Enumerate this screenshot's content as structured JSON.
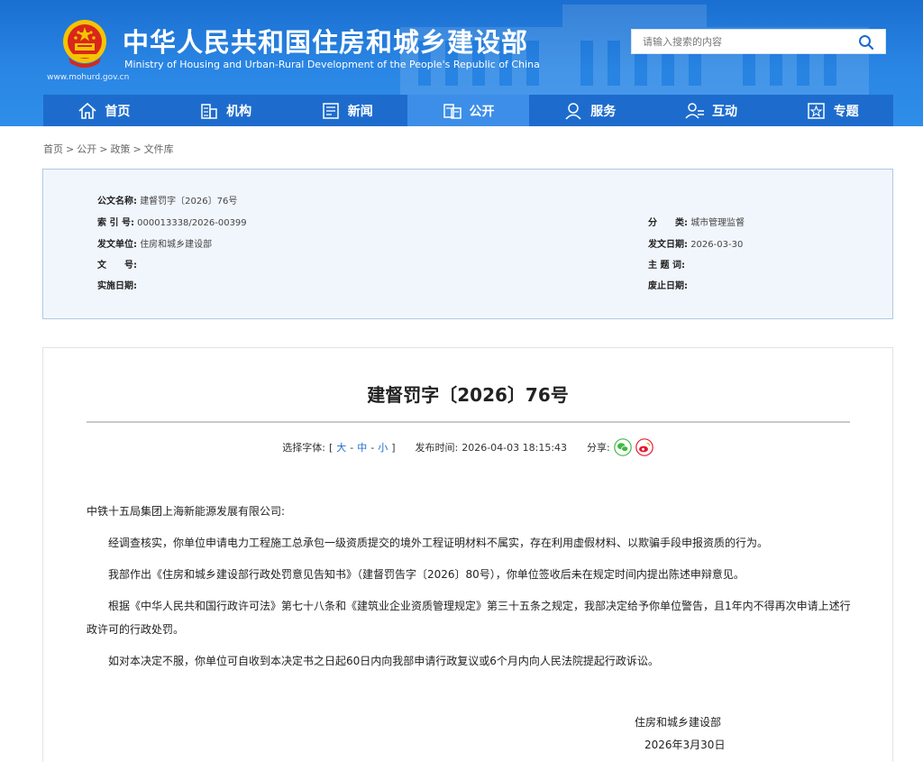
{
  "header": {
    "title": "中华人民共和国住房和城乡建设部",
    "subtitle": "Ministry of Housing and Urban-Rural Development of the People's Republic of China",
    "url": "www.mohurd.gov.cn",
    "search_placeholder": "请输入搜索的内容"
  },
  "nav": {
    "items": [
      {
        "label": "首页",
        "icon": "home-icon"
      },
      {
        "label": "机构",
        "icon": "org-icon"
      },
      {
        "label": "新闻",
        "icon": "news-icon"
      },
      {
        "label": "公开",
        "icon": "public-icon",
        "active": true
      },
      {
        "label": "服务",
        "icon": "service-icon"
      },
      {
        "label": "互动",
        "icon": "interact-icon"
      },
      {
        "label": "专题",
        "icon": "topic-icon"
      }
    ]
  },
  "breadcrumb": [
    "首页",
    "公开",
    "政策",
    "文件库"
  ],
  "meta": {
    "doc_name_label": "公文名称:",
    "doc_name": "建督罚字〔2026〕76号",
    "index_label": "索 引 号:",
    "index": "000013338/2026-00399",
    "category_label": "分　　类:",
    "category": "城市管理监督",
    "issuer_label": "发文单位:",
    "issuer": "住房和城乡建设部",
    "issue_date_label": "发文日期:",
    "issue_date": "2026-03-30",
    "doc_no_label": "文　　号:",
    "doc_no": "",
    "keywords_label": "主 题 词:",
    "keywords": "",
    "effective_label": "实施日期:",
    "effective": "",
    "expiry_label": "废止日期:",
    "expiry": ""
  },
  "article": {
    "title": "建督罚字〔2026〕76号",
    "font_label": "选择字体:",
    "font_open": "[",
    "font_large": "大",
    "font_medium": "中",
    "font_small": "小",
    "font_close": "]",
    "font_dash": "-",
    "publish_label": "发布时间:",
    "publish_time": "2026-04-03 18:15:43",
    "share_label": "分享:",
    "addressee": "中铁十五局集团上海新能源发展有限公司:",
    "paragraphs": [
      "经调查核实，你单位申请电力工程施工总承包一级资质提交的境外工程证明材料不属实，存在利用虚假材料、以欺骗手段申报资质的行为。",
      "我部作出《住房和城乡建设部行政处罚意见告知书》（建督罚告字〔2026〕80号），你单位签收后未在规定时间内提出陈述申辩意见。",
      "根据《中华人民共和国行政许可法》第七十八条和《建筑业企业资质管理规定》第三十五条之规定，我部决定给予你单位警告，且1年内不得再次申请上述行政许可的行政处罚。",
      "如对本决定不服，你单位可自收到本决定书之日起60日内向我部申请行政复议或6个月内向人民法院提起行政诉讼。"
    ],
    "signature": "住房和城乡建设部",
    "sign_date": "2026年3月30日"
  },
  "colors": {
    "header_blue": "#2a86e4",
    "nav_blue": "#1d6ccd",
    "nav_active": "#3d8ee8",
    "meta_bg": "#f1f6fc",
    "wechat_green": "#3fb93f",
    "weibo_red": "#e6162d"
  }
}
